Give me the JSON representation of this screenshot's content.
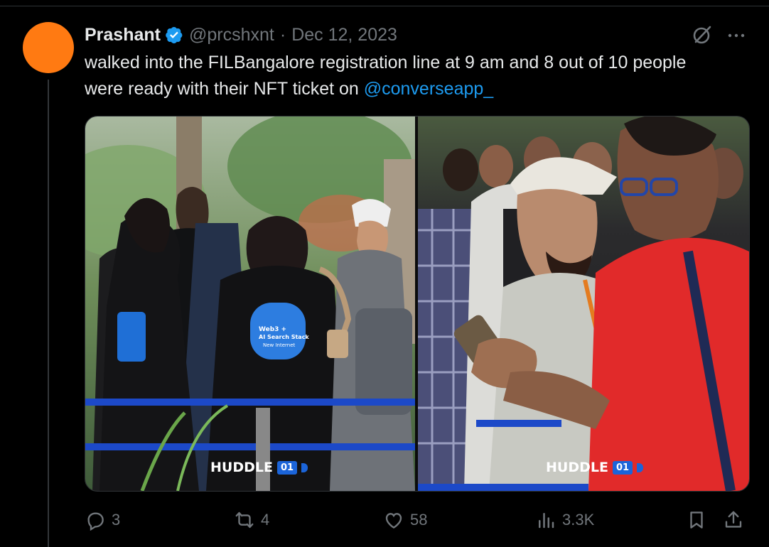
{
  "author": {
    "name": "Prashant",
    "handle": "@prcshxnt",
    "separator": "·",
    "date": "Dec 12, 2023"
  },
  "tweet": {
    "text_before": "walked into the FILBangalore registration line at 9 am and 8 out of 10 people were ready with their NFT ticket on ",
    "mention": "@converseapp_"
  },
  "media": {
    "left_photo": {
      "badge_text": "HUDDLE",
      "badge_num": "01",
      "shirt_text_line1": "Web3 +",
      "shirt_text_line2": "AI Search Stack",
      "shirt_text_line3": "New Internet"
    },
    "right_photo": {
      "badge_text": "HUDDLE",
      "badge_num": "01"
    }
  },
  "actions": {
    "replies": "3",
    "reposts": "4",
    "likes": "58",
    "views": "3.3K"
  },
  "colors": {
    "background": "#000000",
    "text": "#e7e9ea",
    "muted": "#71767b",
    "link": "#1d9bf0",
    "avatar": "#ff7a12",
    "verified": "#1d9bf0"
  },
  "icons": [
    "verified-badge-icon",
    "grok-icon",
    "more-icon",
    "reply-icon",
    "repost-icon",
    "like-icon",
    "views-icon",
    "bookmark-icon",
    "share-icon"
  ]
}
